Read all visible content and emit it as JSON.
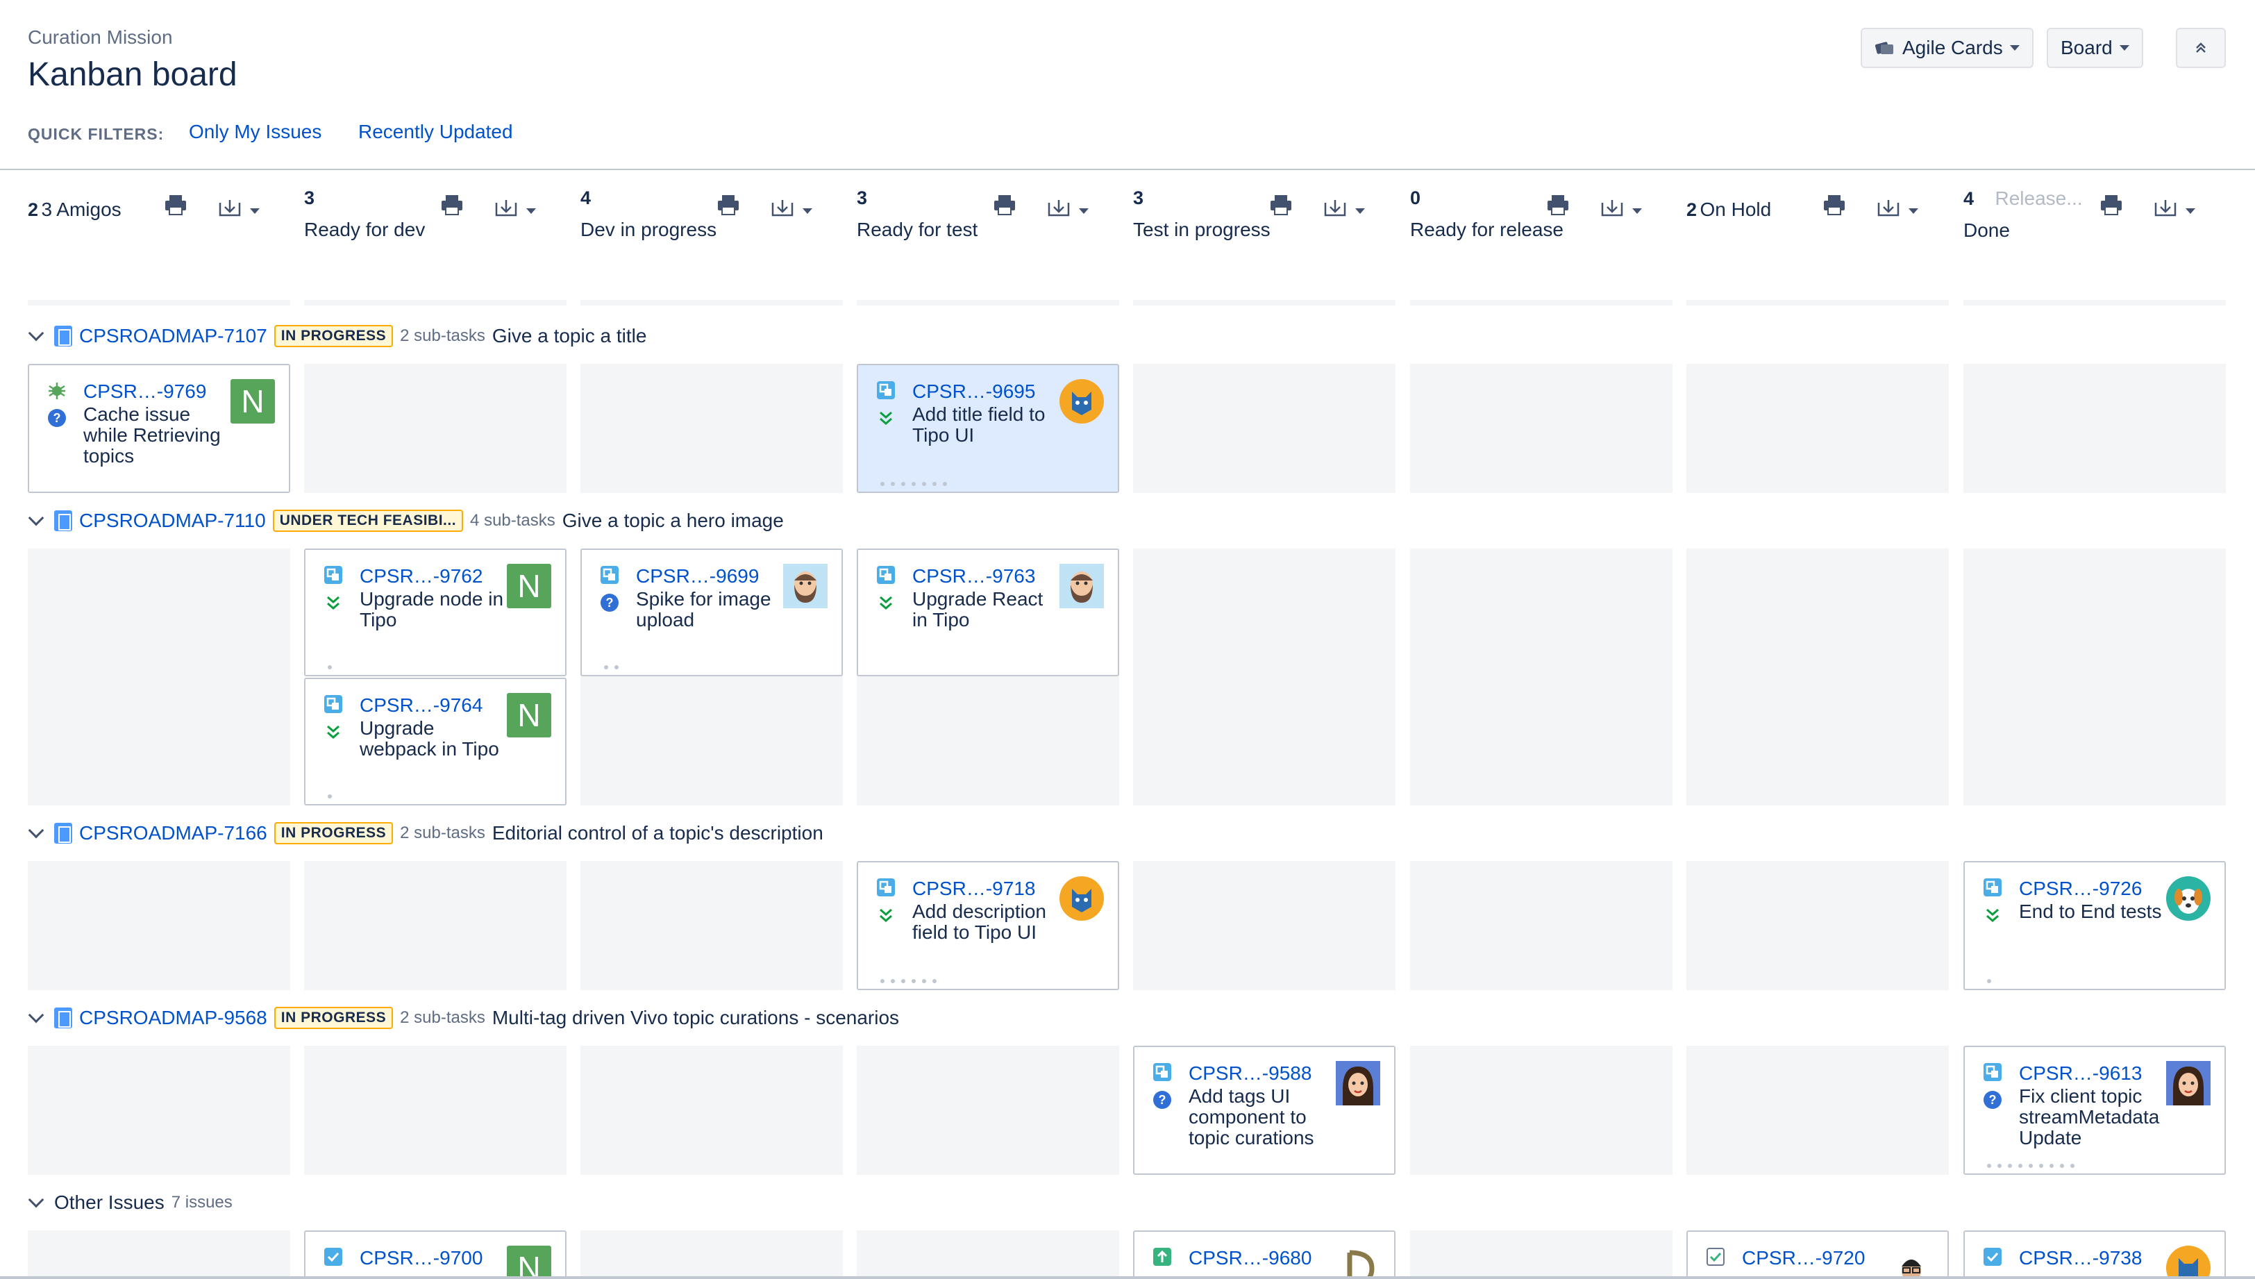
{
  "header": {
    "project": "Curation Mission",
    "title": "Kanban board",
    "quick_filters_label": "QUICK FILTERS:",
    "filters": [
      "Only My Issues",
      "Recently Updated"
    ],
    "buttons": {
      "agile_cards": "Agile Cards",
      "board": "Board"
    }
  },
  "columns": [
    {
      "count": "2",
      "name": "3 Amigos",
      "inline": true
    },
    {
      "count": "3",
      "name": "Ready for dev"
    },
    {
      "count": "4",
      "name": "Dev in progress"
    },
    {
      "count": "3",
      "name": "Ready for test"
    },
    {
      "count": "3",
      "name": "Test in progress"
    },
    {
      "count": "0",
      "name": "Ready for release"
    },
    {
      "count": "2",
      "name": "On Hold",
      "inline": true
    },
    {
      "count": "4",
      "name": "Done",
      "hint": "Release..."
    }
  ],
  "swimlanes": [
    {
      "key": "CPSROADMAP-7107",
      "status": "IN PROGRESS",
      "subtasks": "2 sub-tasks",
      "summary": "Give a topic a title"
    },
    {
      "key": "CPSROADMAP-7110",
      "status": "UNDER TECH FEASIBI...",
      "subtasks": "4 sub-tasks",
      "summary": "Give a topic a hero image"
    },
    {
      "key": "CPSROADMAP-7166",
      "status": "IN PROGRESS",
      "subtasks": "2 sub-tasks",
      "summary": "Editorial control of a topic's description"
    },
    {
      "key": "CPSROADMAP-9568",
      "status": "IN PROGRESS",
      "subtasks": "2 sub-tasks",
      "summary": "Multi-tag driven Vivo topic curations - scenarios"
    }
  ],
  "other_issues": {
    "label": "Other Issues",
    "count": "7 issues"
  },
  "cards": {
    "c9769": {
      "key": "CPSR…-9769",
      "summary": "Cache issue while Retrieving topics",
      "avatar": "N"
    },
    "c9695": {
      "key": "CPSR…-9695",
      "summary": "Add title field to Tipo UI"
    },
    "c9762": {
      "key": "CPSR…-9762",
      "summary": "Upgrade node in Tipo",
      "avatar": "N"
    },
    "c9699": {
      "key": "CPSR…-9699",
      "summary": "Spike for image upload"
    },
    "c9763": {
      "key": "CPSR…-9763",
      "summary": "Upgrade React in Tipo"
    },
    "c9764": {
      "key": "CPSR…-9764",
      "summary": "Upgrade webpack in Tipo",
      "avatar": "N"
    },
    "c9718": {
      "key": "CPSR…-9718",
      "summary": "Add description field to Tipo UI"
    },
    "c9726": {
      "key": "CPSR…-9726",
      "summary": "End to End tests"
    },
    "c9588": {
      "key": "CPSR…-9588",
      "summary": "Add tags UI component to topic curations"
    },
    "c9613": {
      "key": "CPSR…-9613",
      "summary": "Fix client topic streamMetadata Update"
    },
    "c9700": {
      "key": "CPSR…-9700",
      "avatar": "N"
    },
    "c9680": {
      "key": "CPSR…-9680"
    },
    "c9720": {
      "key": "CPSR…-9720"
    },
    "c9738": {
      "key": "CPSR…-9738"
    }
  },
  "colors": {
    "link": "#0052cc",
    "lozenge_border": "#ffab00",
    "avatar_n": "#57a55a",
    "cell_bg": "#f4f5f7",
    "selected_card": "#deebff"
  }
}
